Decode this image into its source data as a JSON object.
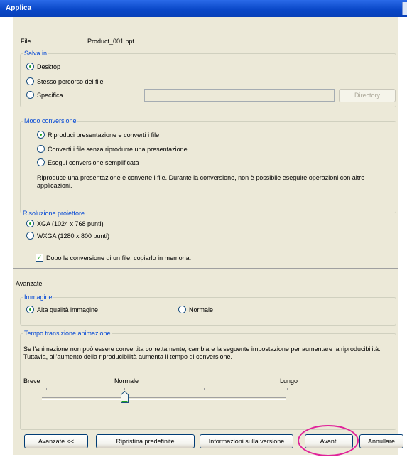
{
  "window": {
    "title": "Applica"
  },
  "file": {
    "label": "File",
    "value": "Product_001.ppt"
  },
  "save_in": {
    "legend": "Salva in",
    "options": [
      "Desktop",
      "Stesso percorso del file",
      "Specifica"
    ],
    "selected": "Desktop",
    "path_value": "",
    "directory_button": "Directory"
  },
  "conversion_mode": {
    "legend": "Modo conversione",
    "options": [
      "Riproduci presentazione e converti i file",
      "Converti i file senza riprodurre una presentazione",
      "Esegui conversione semplificata"
    ],
    "selected": "Riproduci presentazione e converti i file",
    "description": "Riproduce una presentazione e converte i file. Durante la conversione, non è possibile eseguire operazioni con altre applicazioni."
  },
  "projector_resolution": {
    "legend": "Risoluzione proiettore",
    "options": [
      "XGA (1024 x 768 punti)",
      "WXGA (1280 x 800 punti)"
    ],
    "selected": "XGA (1024 x 768 punti)"
  },
  "copy_to_memory": {
    "label": "Dopo la conversione di un file, copiarlo in memoria.",
    "checked": true
  },
  "advanced": {
    "title": "Avanzate",
    "image": {
      "legend": "Immagine",
      "options": [
        "Alta qualità immagine",
        "Normale"
      ],
      "selected": "Alta qualità immagine"
    },
    "animation": {
      "legend": "Tempo transizione animazione",
      "description": "Se l'animazione non può essere convertita correttamente, cambiare la seguente impostazione per aumentare la riproducibilità. Tuttavia, all'aumento della riproducibilità aumenta il tempo di conversione.",
      "labels": [
        "Breve",
        "Normale",
        "Lungo"
      ],
      "value": "Normale",
      "steps": 5,
      "position_index": 1
    }
  },
  "buttons": {
    "advanced_toggle": "Avanzate <<",
    "restore_defaults": "Ripristina predefinite",
    "version_info": "Informazioni sulla versione",
    "next": "Avanti",
    "cancel": "Annullare"
  },
  "colors": {
    "title_bar": "#0a48c8",
    "group_label": "#0046d5",
    "highlight_ring": "#e0249a"
  }
}
